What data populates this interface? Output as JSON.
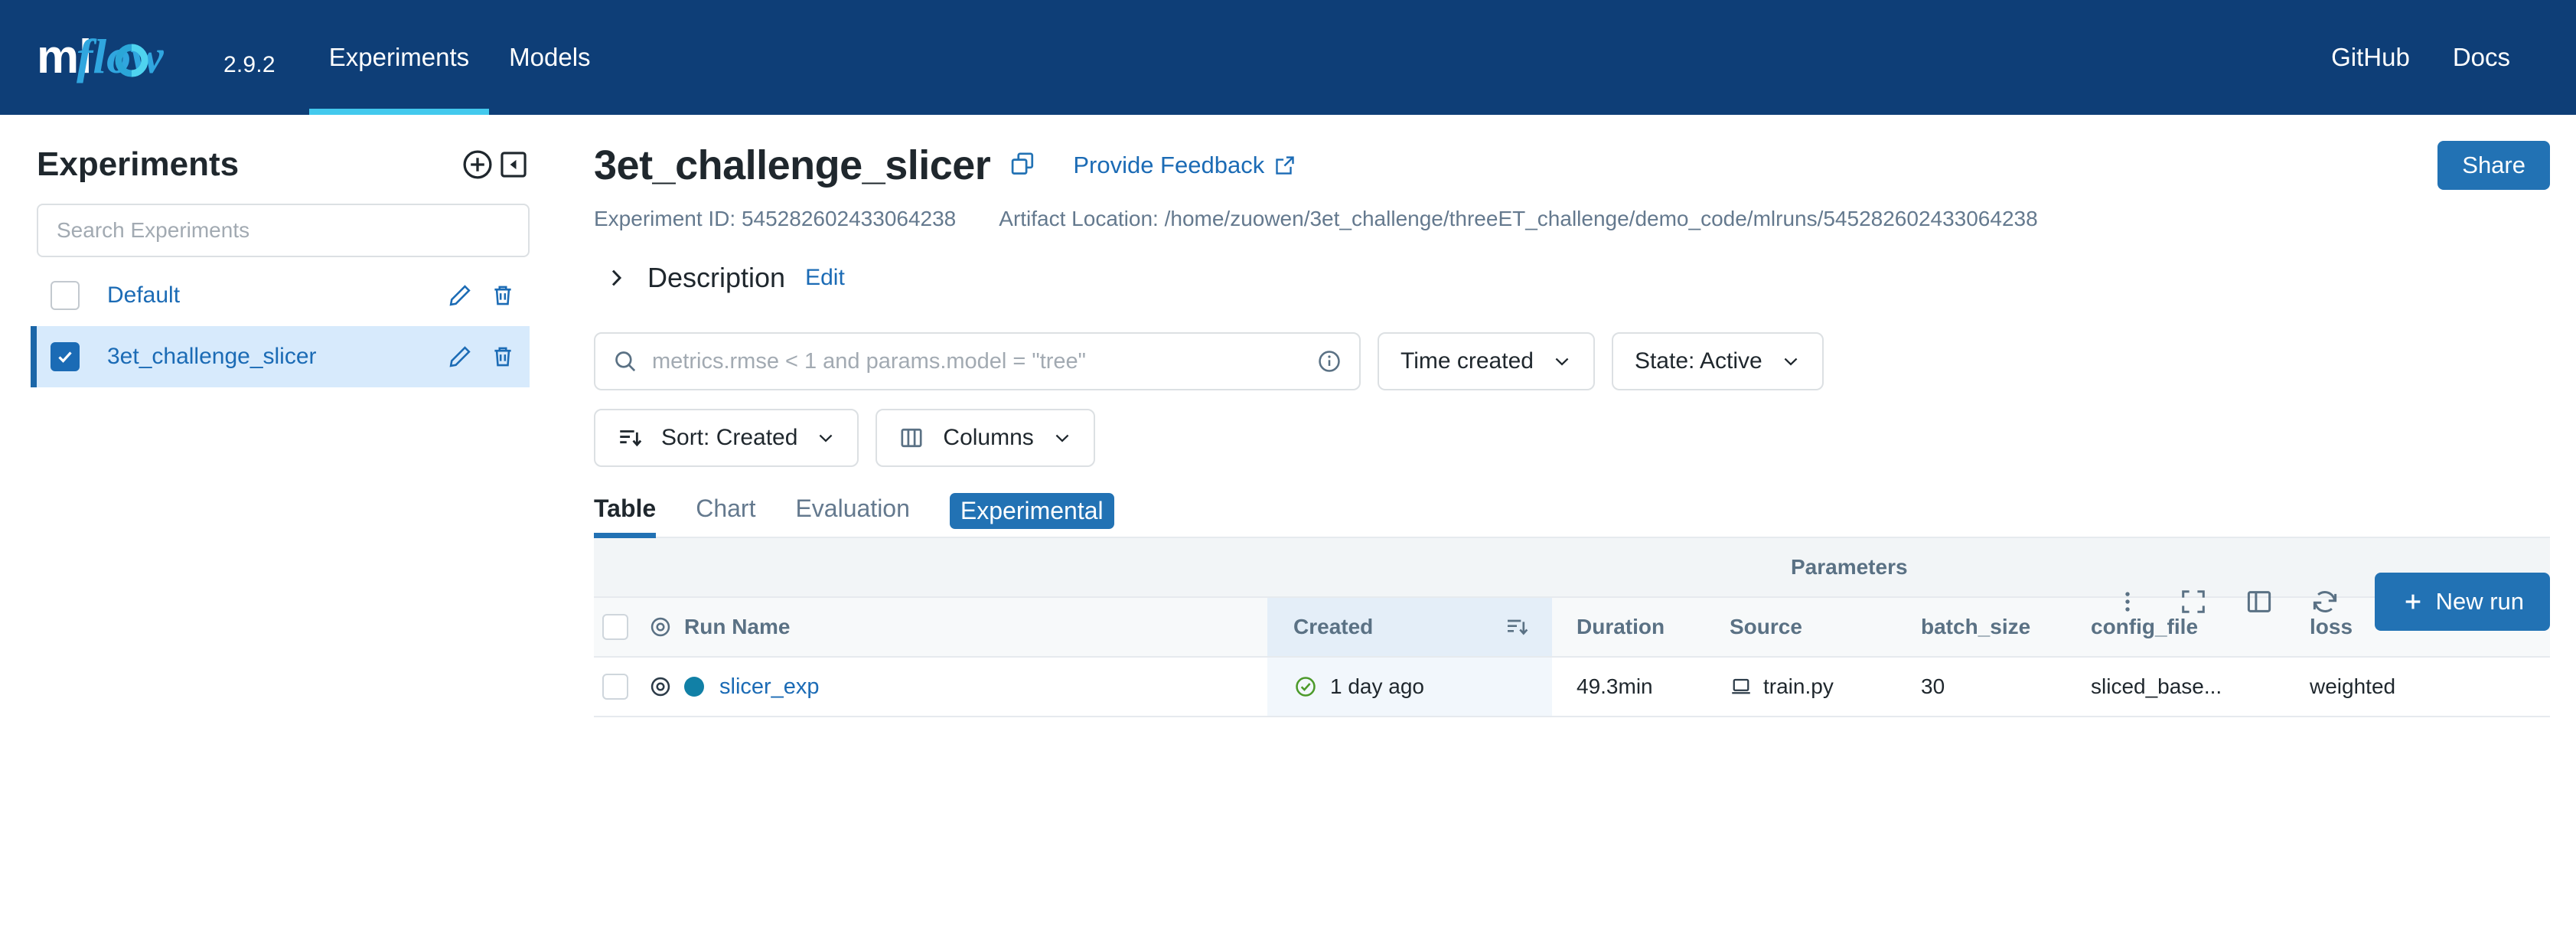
{
  "app": {
    "brand": "mlflow",
    "version": "2.9.2",
    "nav": [
      {
        "label": "Experiments",
        "active": true
      },
      {
        "label": "Models",
        "active": false
      }
    ],
    "nav_right": [
      {
        "label": "GitHub"
      },
      {
        "label": "Docs"
      }
    ],
    "colors": {
      "navbar_bg": "#0e3e77",
      "accent_underline": "#43c9ed",
      "primary_blue": "#2272b4",
      "link_blue": "#1b6bb5",
      "muted_text": "#64798e",
      "success_green": "#4c9a2a",
      "run_dot": "#1180a6"
    }
  },
  "sidebar": {
    "title": "Experiments",
    "create_icon": "plus-circle-icon",
    "collapse_icon": "collapse-sidebar-icon",
    "search": {
      "placeholder": "Search Experiments",
      "value": ""
    },
    "items": [
      {
        "label": "Default",
        "checked": false,
        "selected": false,
        "edit_icon": "pencil-icon",
        "delete_icon": "trash-icon"
      },
      {
        "label": "3et_challenge_slicer",
        "checked": true,
        "selected": true,
        "edit_icon": "pencil-icon",
        "delete_icon": "trash-icon"
      }
    ]
  },
  "header": {
    "title": "3et_challenge_slicer",
    "copy_icon": "copy-icon",
    "feedback_label": "Provide Feedback",
    "feedback_icon": "external-link-icon",
    "share_label": "Share",
    "experiment_id": "Experiment ID: 545282602433064238",
    "artifact_location": "Artifact Location: /home/zuowen/3et_challenge/threeET_challenge/demo_code/mlruns/545282602433064238",
    "description_label": "Description",
    "description_edit": "Edit",
    "description_chevron": "chevron-right-icon"
  },
  "toolbar": {
    "search_placeholder": "metrics.rmse < 1 and params.model = \"tree\"",
    "search_value": "",
    "search_icon": "search-icon",
    "info_icon": "info-circle-icon",
    "time_created_label": "Time created",
    "state_label": "State: Active",
    "sort_label": "Sort: Created",
    "sort_icon": "sort-descending-icon",
    "columns_label": "Columns",
    "columns_icon": "columns-icon",
    "kebab_icon": "more-vertical-icon",
    "fullscreen_icon": "fullscreen-icon",
    "panel_icon": "side-panel-icon",
    "refresh_icon": "refresh-icon",
    "new_run_label": "New run",
    "new_run_icon": "plus-icon"
  },
  "tabs": [
    {
      "label": "Table",
      "active": true,
      "badge": false
    },
    {
      "label": "Chart",
      "active": false,
      "badge": false
    },
    {
      "label": "Evaluation",
      "active": false,
      "badge": false
    },
    {
      "label": "Experimental",
      "active": false,
      "badge": true
    }
  ],
  "table": {
    "group_header": "Parameters",
    "columns": {
      "run_name": "Run Name",
      "created": "Created",
      "duration": "Duration",
      "source": "Source",
      "batch_size": "batch_size",
      "config_file": "config_file",
      "loss": "loss"
    },
    "header_icons": {
      "eye": "eye-icon",
      "created_sort": "sort-descending-icon"
    },
    "rows": [
      {
        "checked": false,
        "eye_icon": "eye-icon",
        "run_name": "slicer_exp",
        "status_icon": "check-circle-icon",
        "created": "1 day ago",
        "duration": "49.3min",
        "source_icon": "laptop-icon",
        "source": "train.py",
        "batch_size": "30",
        "config_file": "sliced_base...",
        "loss": "weighted"
      }
    ]
  }
}
